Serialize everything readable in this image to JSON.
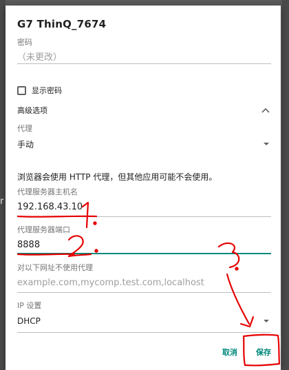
{
  "dialog": {
    "title": "G7 ThinQ_7674",
    "password": {
      "label": "密码",
      "placeholder": "（未更改）"
    },
    "show_password_label": "显示密码",
    "advanced_options_label": "高级选项",
    "proxy": {
      "label": "代理",
      "value": "手动"
    },
    "proxy_notice": "浏览器会使用 HTTP 代理，但其他应用可能不会使用。",
    "proxy_hostname": {
      "label": "代理服务器主机名",
      "value": "192.168.43.10"
    },
    "proxy_port": {
      "label": "代理服务器端口",
      "value": "8888"
    },
    "bypass": {
      "label": "对以下网址不使用代理",
      "placeholder": "example.com,mycomp.test.com,localhost"
    },
    "ip_settings": {
      "label": "IP 设置",
      "value": "DHCP"
    },
    "cancel_label": "取消",
    "save_label": "保存"
  },
  "background": {
    "peek_text": "r"
  },
  "annotations": [
    "1.",
    "2.",
    "3."
  ],
  "colors": {
    "accent": "#00897b",
    "annotation": "#e60000"
  }
}
